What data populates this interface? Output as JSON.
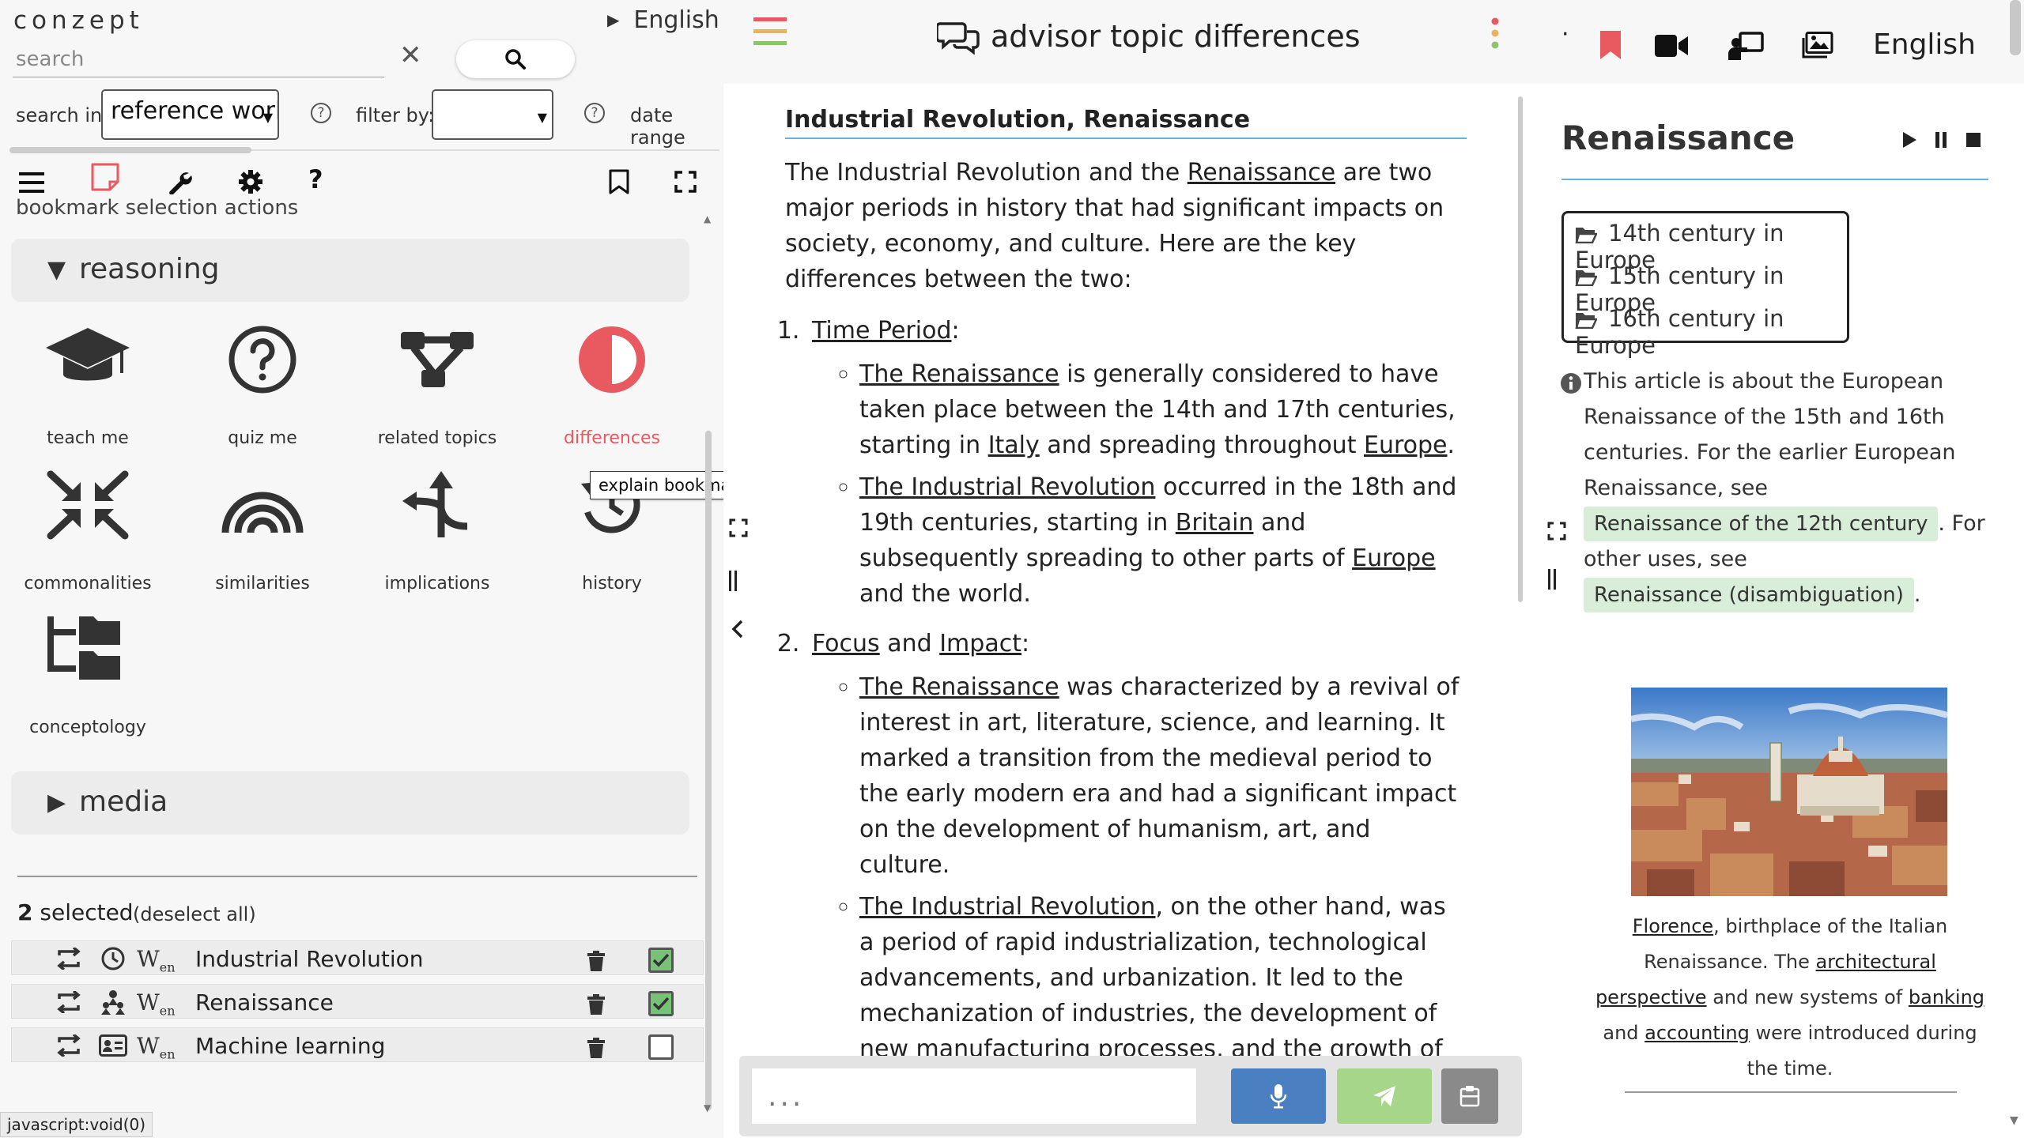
{
  "left": {
    "brand": "conzept",
    "language": "English",
    "search": {
      "placeholder": "search",
      "value": ""
    },
    "search_in_label": "search in:",
    "search_in_value": "reference worl",
    "filter_by_label": "filter by:",
    "filter_by_value": "",
    "date_range_label": "date range",
    "bookmark_actions_label": "bookmark selection actions",
    "sections": {
      "reasoning": "reasoning",
      "media": "media"
    },
    "tiles": [
      {
        "label": "teach me",
        "icon": "graduation-cap-icon"
      },
      {
        "label": "quiz me",
        "icon": "question-circle-icon"
      },
      {
        "label": "related topics",
        "icon": "topic-graph-icon"
      },
      {
        "label": "differences",
        "icon": "half-circle-icon"
      },
      {
        "label": "commonalities",
        "icon": "compress-arrows-icon"
      },
      {
        "label": "similarities",
        "icon": "rainbow-icon"
      },
      {
        "label": "implications",
        "icon": "split-arrow-icon"
      },
      {
        "label": "history",
        "icon": "history-icon"
      },
      {
        "label": "conceptology",
        "icon": "folder-tree-icon"
      }
    ],
    "tooltip": "explain bookmark differences",
    "selected_count": "2",
    "selected_label": "selected",
    "deselect_all": "(deselect all)",
    "selection_rows": [
      {
        "name": "Industrial Revolution",
        "icon": "clock-icon",
        "checked": true
      },
      {
        "name": "Renaissance",
        "icon": "people-icon",
        "checked": true
      },
      {
        "name": "Machine learning",
        "icon": "id-card-icon",
        "checked": false
      }
    ],
    "wiki_badge": "W",
    "wiki_badge_sub": "en",
    "status_url": "javascript:void(0)",
    "accent": "#e85a5f"
  },
  "middle": {
    "title": "advisor topic differences",
    "article_title": "Industrial Revolution, Renaissance",
    "intro": {
      "t1": "The Industrial Revolution and the ",
      "link": "Renaissance",
      "t2": " are two major periods in history that had significant impacts on society, economy, and culture. Here are the key differences between the two:"
    },
    "item1": {
      "num": "1.",
      "label": "Time Period",
      "colon": ":",
      "b1": {
        "link1": "The Renaissance",
        "t1": " is generally considered to have taken place between the 14th and 17th centuries, starting in ",
        "link2": "Italy",
        "t2": " and spreading throughout ",
        "link3": "Europe",
        "t3": "."
      },
      "b2": {
        "link1": "The Industrial Revolution",
        "t1": " occurred in the 18th and 19th centuries, starting in ",
        "link2": "Britain",
        "t2": " and subsequently spreading to other parts of ",
        "link3": "Europe",
        "t3": " and the world."
      }
    },
    "item2": {
      "num": "2.",
      "label1": "Focus",
      "and": " and ",
      "label2": "Impact",
      "colon": ":",
      "b1": {
        "link1": "The Renaissance",
        "t1": " was characterized by a revival of interest in art, literature, science, and learning. It marked a transition from the medieval period to the early modern era and had a significant impact on the development of humanism, art, and culture."
      },
      "b2": {
        "link1": "The Industrial Revolution",
        "t1": ", on the other hand, was a period of rapid industrialization, technological advancements, and urbanization. It led to the mechanization of industries, the development of new manufacturing processes, and the growth of cities."
      }
    },
    "chat_placeholder": "...",
    "colors": {
      "mic": "#4a7fc1",
      "send": "#a5d68a",
      "clipboard": "#8a8a8a"
    }
  },
  "right": {
    "language": "English",
    "title": "Renaissance",
    "categories": [
      "14th century in Europe",
      "15th century in Europe",
      "16th century in Europe"
    ],
    "note_text": "This article is about the European Renaissance of the 15th and 16th centuries. For the earlier European Renaissance, see",
    "pill1": "Renaissance of the 12th century",
    "note_mid": ". For other uses, see",
    "pill2": "Renaissance (disambiguation)",
    "note_end": ".",
    "caption": {
      "link1": "Florence",
      "t1": ", birthplace of the Italian Renaissance. The ",
      "link2": "architectural perspective",
      "t2": " and new systems of ",
      "link3": "banking",
      "t3": " and ",
      "link4": "accounting",
      "t4": " were introduced during the time."
    },
    "image_alt": "Florence cityscape with cathedral dome"
  }
}
